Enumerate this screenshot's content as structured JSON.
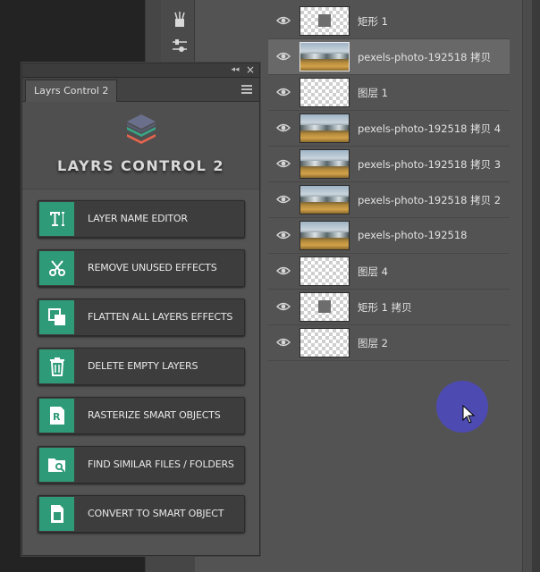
{
  "panel": {
    "tab_label": "Layrs Control 2",
    "brand_title": "LAYRS CONTROL 2",
    "collapse_glyph": "◂◂",
    "close_glyph": "×",
    "actions": [
      {
        "label": "LAYER NAME EDITOR",
        "icon": "text-cursor-icon"
      },
      {
        "label": "REMOVE UNUSED EFFECTS",
        "icon": "scissors-icon"
      },
      {
        "label": "FLATTEN ALL LAYERS EFFECTS",
        "icon": "flatten-squares-icon"
      },
      {
        "label": "DELETE EMPTY LAYERS",
        "icon": "trash-icon"
      },
      {
        "label": "RASTERIZE SMART OBJECTS",
        "icon": "rasterize-doc-icon"
      },
      {
        "label": "FIND SIMILAR FILES  / FOLDERS",
        "icon": "folder-search-icon"
      },
      {
        "label": "CONVERT TO SMART OBJECT",
        "icon": "smart-object-doc-icon"
      }
    ]
  },
  "layers": [
    {
      "name": "矩形 1",
      "thumb": "shape",
      "selected": false
    },
    {
      "name": "pexels-photo-192518 拷贝",
      "thumb": "photo",
      "selected": true
    },
    {
      "name": "图层 1",
      "thumb": "empty",
      "selected": false
    },
    {
      "name": "pexels-photo-192518 拷贝 4",
      "thumb": "photo",
      "selected": false
    },
    {
      "name": "pexels-photo-192518 拷贝 3",
      "thumb": "photo",
      "selected": false
    },
    {
      "name": "pexels-photo-192518 拷贝 2",
      "thumb": "photo",
      "selected": false
    },
    {
      "name": "pexels-photo-192518",
      "thumb": "photo",
      "selected": false
    },
    {
      "name": "图层 4",
      "thumb": "empty",
      "selected": false
    },
    {
      "name": "矩形 1 拷贝",
      "thumb": "shape",
      "selected": false
    },
    {
      "name": "图层 2",
      "thumb": "empty",
      "selected": false
    }
  ],
  "colors": {
    "accent": "#2e9a78",
    "cursor_halo": "#4d4bb2",
    "selected_row": "#686868"
  }
}
